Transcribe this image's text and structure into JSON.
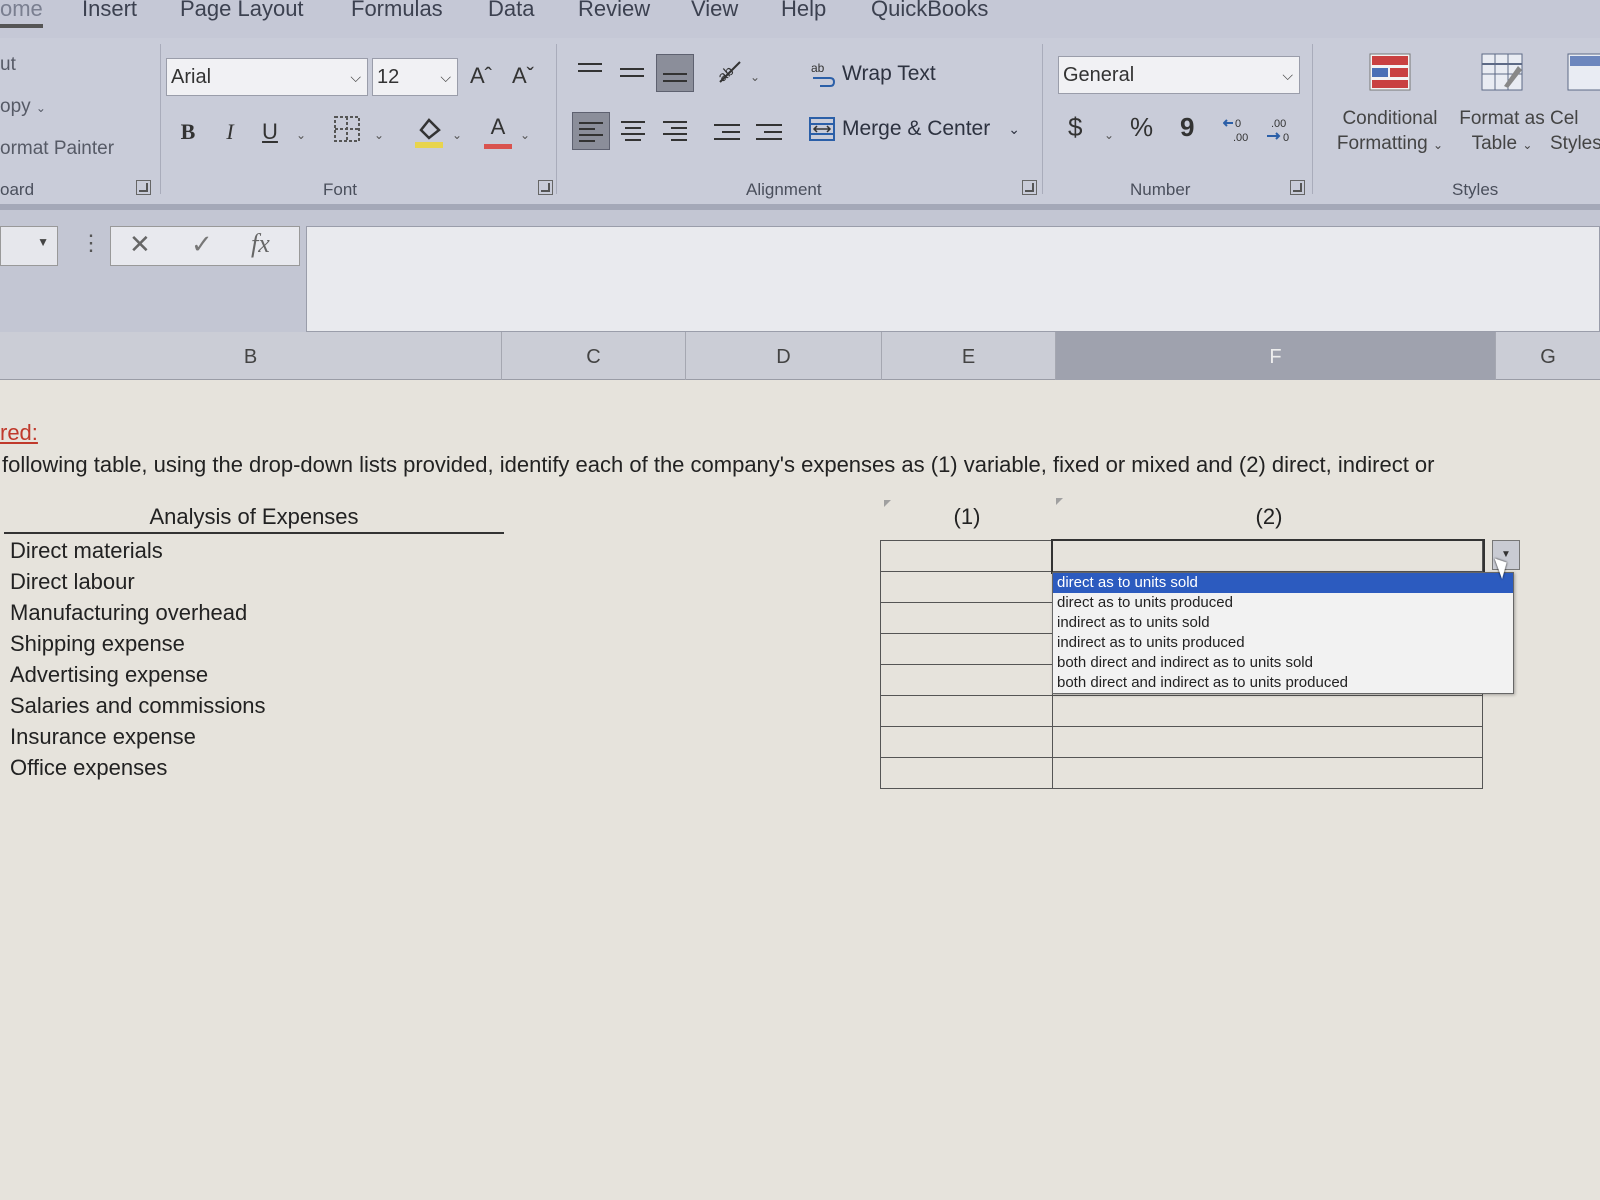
{
  "tabs": [
    "ome",
    "Insert",
    "Page Layout",
    "Formulas",
    "Data",
    "Review",
    "View",
    "Help",
    "QuickBooks"
  ],
  "clipboard": {
    "cut_label": "ut",
    "copy_label": "opy",
    "format_painter_label": "ormat Painter",
    "group_label": "oard"
  },
  "font": {
    "family": "Arial",
    "size": "12",
    "grow_label": "Aˆ",
    "shrink_label": "Aˇ",
    "bold_label": "B",
    "italic_label": "I",
    "underline_label": "U",
    "font_color_label": "A",
    "group_label": "Font"
  },
  "alignment": {
    "wrap_text_label": "Wrap Text",
    "merge_center_label": "Merge & Center",
    "group_label": "Alignment"
  },
  "number": {
    "format": "General",
    "currency_label": "$",
    "percent_label": "%",
    "comma_label": "9",
    "group_label": "Number"
  },
  "styles": {
    "conditional_line1": "Conditional",
    "conditional_line2": "Formatting",
    "format_table_line1": "Format as",
    "format_table_line2": "Table",
    "cell_styles_line1": "Cel",
    "cell_styles_line2": "Styles",
    "group_label": "Styles"
  },
  "formula_bar": {
    "cancel_label": "✕",
    "enter_label": "✓",
    "fx_label": "fx",
    "value": ""
  },
  "columns": [
    "B",
    "C",
    "D",
    "E",
    "F",
    "G"
  ],
  "sheet": {
    "required_label": "red:",
    "instruction": "following table, using the drop-down lists provided, identify each of the company's expenses as (1) variable, fixed or mixed and (2) direct, indirect or",
    "analysis_title": "Analysis of Expenses",
    "col1_label": "(1)",
    "col2_label": "(2)",
    "expenses": [
      "Direct materials",
      "Direct labour",
      "Manufacturing overhead",
      "Shipping expense",
      "Advertising expense",
      "Salaries and commissions",
      "Insurance expense",
      "Office expenses"
    ]
  },
  "dropdown": {
    "options": [
      "direct as to units sold",
      "direct as to units produced",
      "indirect as to units sold",
      "indirect as to units produced",
      "both direct and indirect as to units sold",
      "both direct and indirect as to units produced"
    ],
    "selected_index": 0,
    "highlight_color": "#2c5bbf"
  }
}
